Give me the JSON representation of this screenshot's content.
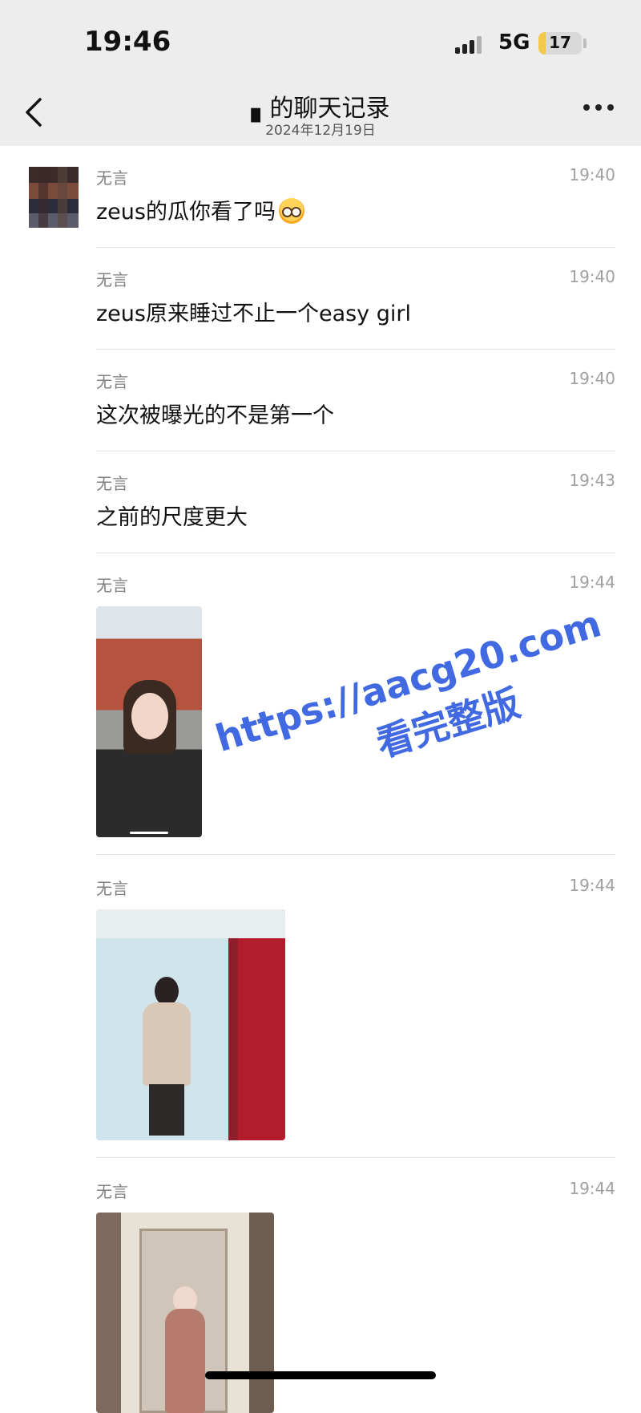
{
  "status_bar": {
    "time": "19:46",
    "network": "5G",
    "battery": "17",
    "battery_level_percent": 17
  },
  "nav": {
    "title": "▖的聊天记录",
    "subtitle": "2024年12月19日"
  },
  "messages": [
    {
      "sender": "无言",
      "time": "19:40",
      "text": "zeus的瓜你看了吗",
      "emoji": "face-with-monocle"
    },
    {
      "sender": "无言",
      "time": "19:40",
      "text": "zeus原来睡过不止一个easy girl"
    },
    {
      "sender": "无言",
      "time": "19:40",
      "text": "这次被曝光的不是第一个"
    },
    {
      "sender": "无言",
      "time": "19:43",
      "text": "之前的尺度更大"
    },
    {
      "sender": "无言",
      "time": "19:44",
      "image": "selfie-photo"
    },
    {
      "sender": "无言",
      "time": "19:44",
      "image": "mirror-photo"
    },
    {
      "sender": "无言",
      "time": "19:44",
      "image": "dress-photo"
    }
  ],
  "watermark": {
    "url": "https://aacg20.com",
    "text": "看完整版"
  },
  "colors": {
    "header_bg": "#ededed",
    "watermark": "#4169e1",
    "battery_fill": "#f2c94c"
  }
}
